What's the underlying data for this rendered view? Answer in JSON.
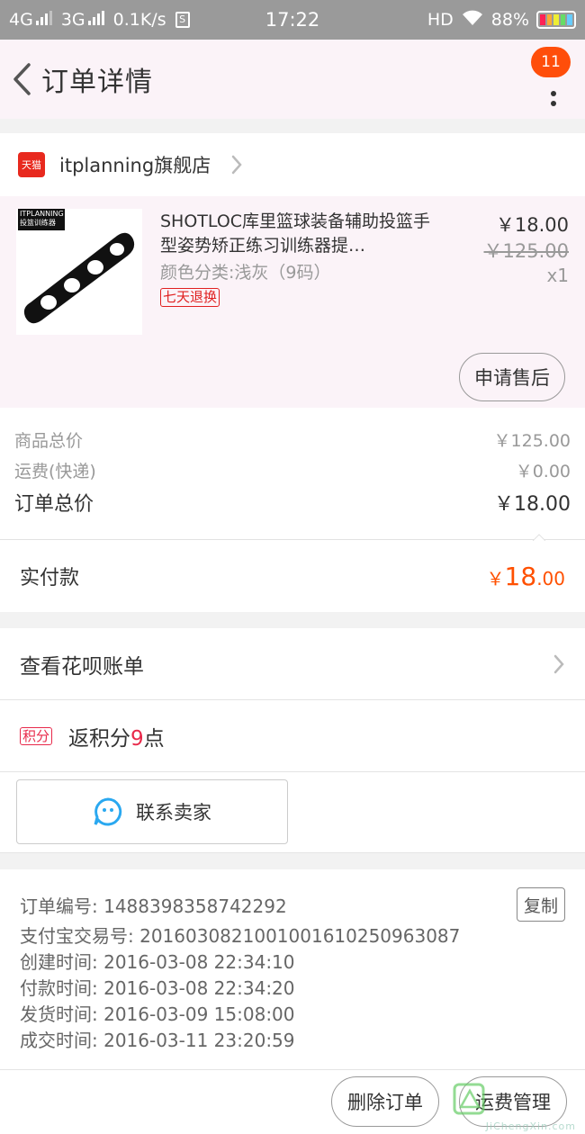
{
  "status_bar": {
    "network1": "4G",
    "network2": "3G",
    "speed": "0.1K/s",
    "time": "17:22",
    "hd": "HD",
    "battery": "88%"
  },
  "nav": {
    "title": "订单详情",
    "badge_count": "11"
  },
  "shop": {
    "tag": "天猫",
    "name": "itplanning旗舰店"
  },
  "product": {
    "brand_text": "ITPLANNING 投篮训练器",
    "title": "SHOTLOC库里篮球装备辅助投篮手型姿势矫正练习训练器提…",
    "sku": "颜色分类:浅灰（9码）",
    "tag": "七天退换",
    "price": "￥18.00",
    "original_price": "￥125.00",
    "quantity": "x1",
    "after_sale_button": "申请售后"
  },
  "summary": {
    "goods_total_label": "商品总价",
    "goods_total_value": "￥125.00",
    "shipping_label": "运费(快递)",
    "shipping_value": "￥0.00",
    "order_total_label": "订单总价",
    "order_total_value": "￥18.00"
  },
  "paid": {
    "label": "实付款",
    "currency": "￥",
    "amount_int": "18",
    "amount_dec": ".00"
  },
  "huabei": {
    "label": "查看花呗账单"
  },
  "points": {
    "tag": "积分",
    "prefix": "返积分",
    "count": "9",
    "suffix": "点"
  },
  "contact": {
    "label": "联系卖家"
  },
  "order_info": {
    "order_no": "订单编号: 1488398358742292",
    "alipay_no": "支付宝交易号: 2016030821001001610250963087",
    "created": "创建时间: 2016-03-08 22:34:10",
    "paid": "付款时间: 2016-03-08 22:34:20",
    "shipped": "发货时间: 2016-03-09 15:08:00",
    "completed": "成交时间: 2016-03-11 23:20:59",
    "copy_button": "复制"
  },
  "actions": {
    "delete": "删除订单",
    "logistics": "运费管理"
  },
  "watermark": {
    "url": "JiChengXin.com"
  },
  "colors": {
    "accent": "#ff5000",
    "tmall_red": "#e8291e",
    "badge": "#ff4e0a",
    "nav_bg": "#fbf3f8"
  }
}
